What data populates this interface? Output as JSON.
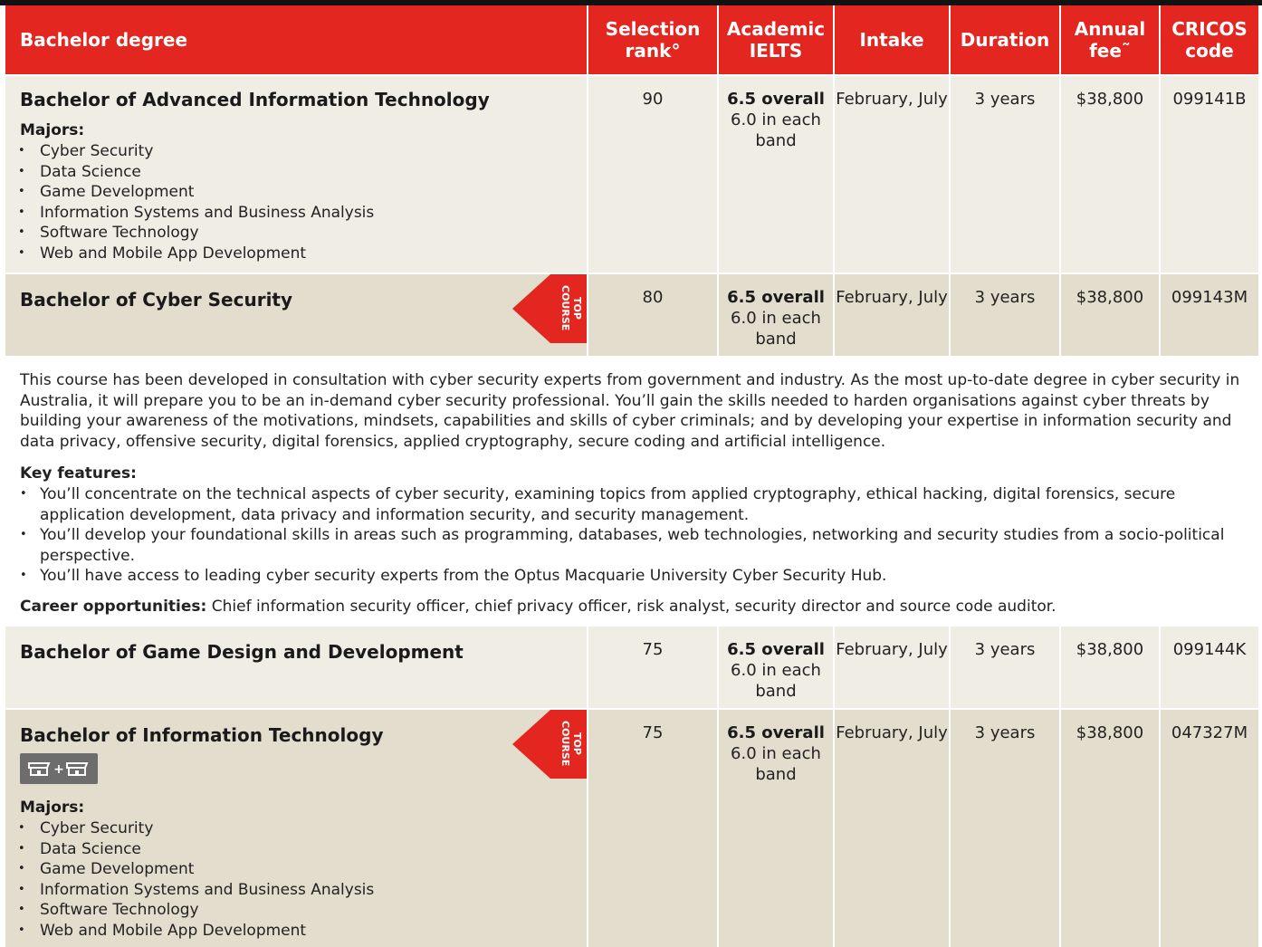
{
  "header": {
    "degree": "Bachelor degree",
    "rank": "Selection rank°",
    "ielts": "Academic IELTS",
    "intake": "Intake",
    "duration": "Duration",
    "fee": "Annual fee˜",
    "cricos": "CRICOS code"
  },
  "ribbon_text": "TOP COURSE",
  "majors_label": "Majors:",
  "courses": [
    {
      "title": "Bachelor of Advanced Information Technology",
      "rank": "90",
      "ielts_overall": "6.5 overall",
      "ielts_band": "6.0 in each band",
      "intake": "February, July",
      "duration": "3 years",
      "fee": "$38,800",
      "cricos": "099141B",
      "majors": [
        "Cyber Security",
        "Data Science",
        "Game Development",
        "Information Systems and Business Analysis",
        "Software Technology",
        "Web and Mobile App Development"
      ]
    },
    {
      "title": "Bachelor of Cyber Security",
      "rank": "80",
      "ielts_overall": "6.5 overall",
      "ielts_band": "6.0 in each band",
      "intake": "February, July",
      "duration": "3 years",
      "fee": "$38,800",
      "cricos": "099143M"
    },
    {
      "title": "Bachelor of Game Design and Development",
      "rank": "75",
      "ielts_overall": "6.5 overall",
      "ielts_band": "6.0 in each band",
      "intake": "February, July",
      "duration": "3 years",
      "fee": "$38,800",
      "cricos": "099144K"
    },
    {
      "title": "Bachelor of Information Technology",
      "rank": "75",
      "ielts_overall": "6.5 overall",
      "ielts_band": "6.0 in each band",
      "intake": "February, July",
      "duration": "3 years",
      "fee": "$38,800",
      "cricos": "047327M",
      "majors": [
        "Cyber Security",
        "Data Science",
        "Game Development",
        "Information Systems and Business Analysis",
        "Software Technology",
        "Web and Mobile App Development"
      ]
    }
  ],
  "cyber_description": {
    "intro": "This course has been developed in consultation with cyber security experts from government and industry. As the most up-to-date degree in cyber security in Australia, it will prepare you to be an in-demand cyber security professional. You’ll gain the skills needed to harden organisations against cyber threats by building your awareness of the motivations, mindsets, capabilities and skills of cyber criminals; and by developing your expertise in information security and data privacy, offensive security, digital forensics, applied cryptography, secure coding and artificial intelligence.",
    "key_features_label": "Key features:",
    "key_features": [
      "You’ll concentrate on the technical aspects of cyber security, examining topics from applied cryptography, ethical hacking, digital forensics, secure application development, data privacy and information security, and security management.",
      "You’ll develop your foundational skills in areas such as programming, databases, web technologies, networking and security studies from a socio-political perspective.",
      "You’ll have access to leading cyber security experts from the Optus Macquarie University Cyber Security Hub."
    ],
    "career_label": "Career opportunities:",
    "career_text": " Chief information security officer, chief privacy officer, risk analyst, security director and source code auditor."
  },
  "icons": {
    "double_degree": "double-degree-icon",
    "ribbon": "top-course-ribbon"
  },
  "colors": {
    "header_red": "#e3261f",
    "row_light": "#f0ede5",
    "row_dark": "#e2ddcc"
  }
}
